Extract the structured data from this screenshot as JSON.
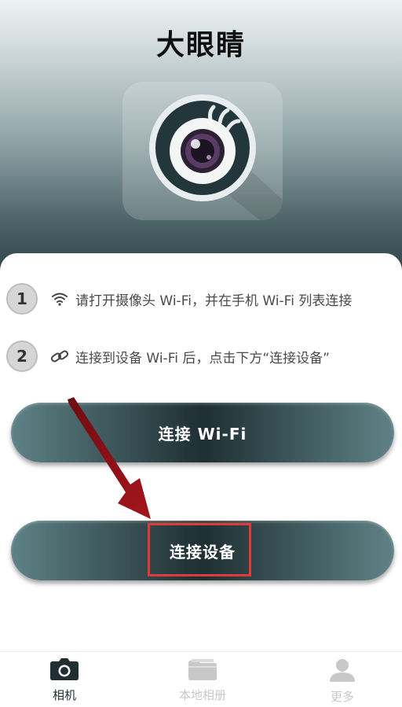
{
  "header": {
    "title": "大眼睛",
    "logo_icon": "eye-camera-logo"
  },
  "steps": [
    {
      "number": "1",
      "icon": "wifi-icon",
      "text": "请打开摄像头 Wi-Fi，并在手机 Wi-Fi 列表连接"
    },
    {
      "number": "2",
      "icon": "link-icon",
      "text": "连接到设备 Wi-Fi 后，点击下方“连接设备”"
    }
  ],
  "buttons": {
    "connect_wifi": "连接 Wi-Fi",
    "connect_device": "连接设备"
  },
  "annotation": {
    "highlight_color": "#e03a3a",
    "arrow_color": "#8c1218"
  },
  "tabbar": {
    "active_color": "#1f2f33",
    "inactive_color": "#c8c8c8",
    "tabs": [
      {
        "label": "相机",
        "icon": "camera-icon",
        "active": true
      },
      {
        "label": "本地相册",
        "icon": "folder-icon",
        "active": false
      },
      {
        "label": "更多",
        "icon": "person-icon",
        "active": false
      }
    ]
  }
}
